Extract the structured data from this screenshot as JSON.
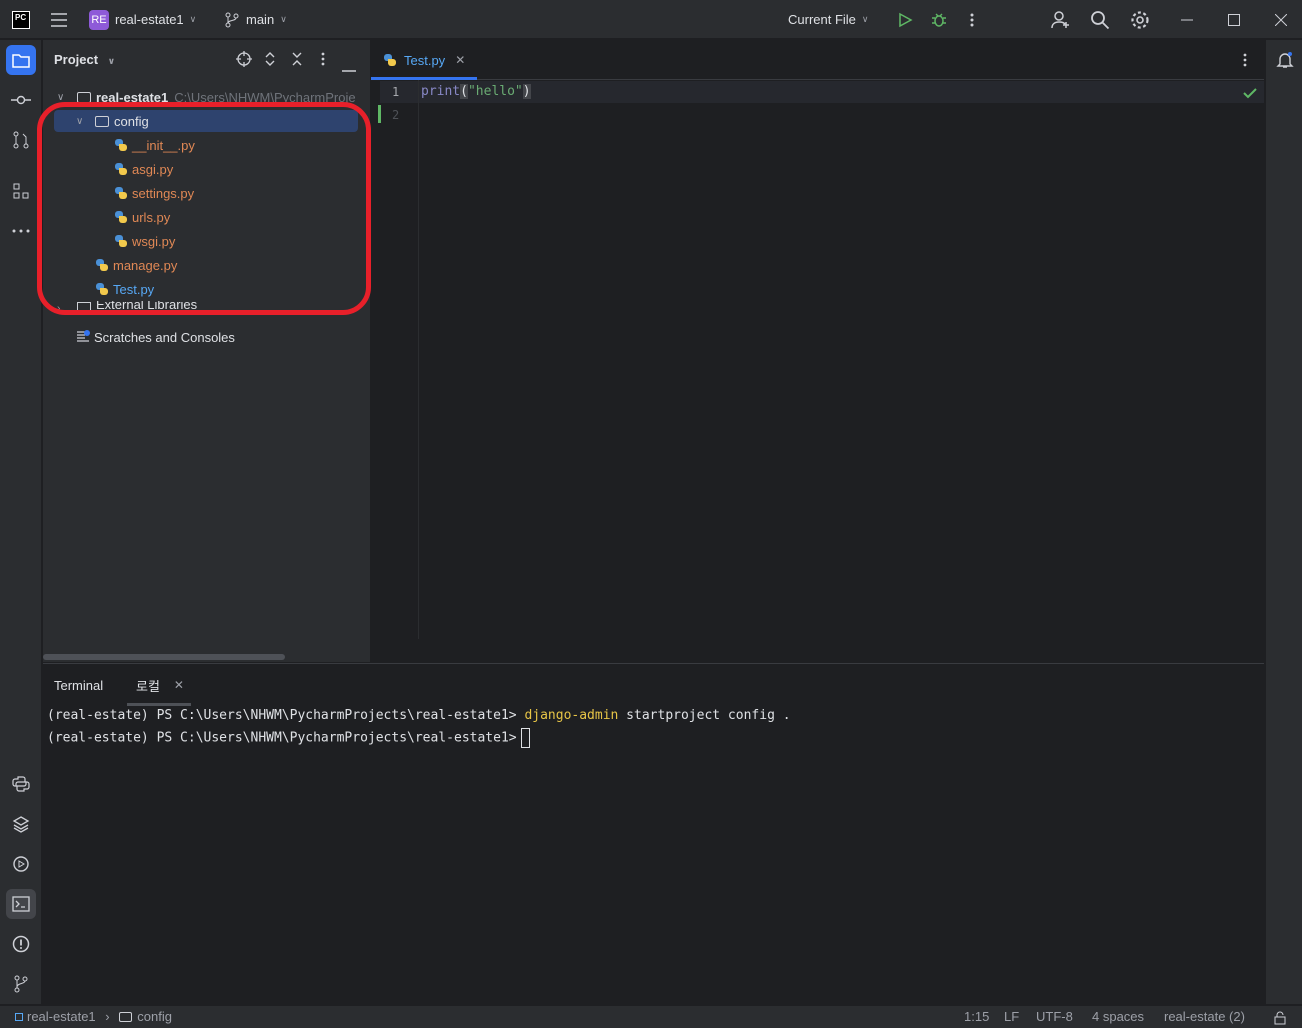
{
  "titlebar": {
    "app_logo": "PC",
    "project_badge": "RE",
    "project_name": "real-estate1",
    "branch": "main",
    "run_config": "Current File"
  },
  "icons": [
    "hamburger-icon",
    "branch-icon",
    "run-icon",
    "debug-icon",
    "more-icon",
    "add-user-icon",
    "search-icon",
    "gear-icon",
    "minimize-icon",
    "maximize-icon",
    "close-icon"
  ],
  "project_panel": {
    "title": "Project",
    "root": {
      "name": "real-estate1",
      "path": "C:\\Users\\NHWM\\PycharmProje"
    },
    "config_folder": "config",
    "config_files": [
      "__init__.py",
      "asgi.py",
      "settings.py",
      "urls.py",
      "wsgi.py"
    ],
    "manage": "manage.py",
    "test": "Test.py",
    "external_libraries": "External Libraries",
    "scratches": "Scratches and Consoles"
  },
  "editor": {
    "tab": "Test.py",
    "lines": [
      {
        "num": "1",
        "fn": "print",
        "open": "(",
        "str": "\"hello\"",
        "close": ")"
      },
      {
        "num": "2"
      }
    ]
  },
  "terminal": {
    "tab_label": "Terminal",
    "session_tab": "로컬",
    "line1_prompt": "(real-estate) PS C:\\Users\\NHWM\\PycharmProjects\\real-estate1> ",
    "line1_cmd": "django-admin",
    "line1_args": " startproject config .",
    "line2_prompt": "(real-estate) PS C:\\Users\\NHWM\\PycharmProjects\\real-estate1>"
  },
  "statusbar": {
    "crumb_project": "real-estate1",
    "crumb_folder": "config",
    "position": "1:15",
    "line_sep": "LF",
    "encoding": "UTF-8",
    "indent": "4 spaces",
    "interpreter": "real-estate (2)"
  },
  "colors": {
    "accent": "#3574f0",
    "annotation": "#e8202a",
    "file_untracked": "#e08855",
    "file_modified": "#57a8f5"
  }
}
